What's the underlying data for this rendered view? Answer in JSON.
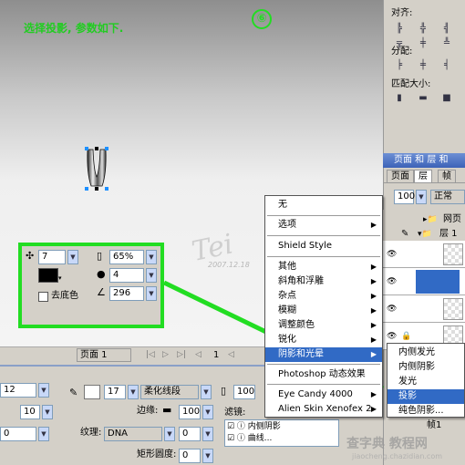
{
  "caption": "选择投影, 参数如下.",
  "step_badge": "⑥",
  "signature": "Tei",
  "signature_date": "2007.12.18",
  "shadow_panel": {
    "distance": "7",
    "opacity": "65%",
    "softness": "4",
    "angle": "296",
    "knockout_label": "去底色",
    "color": "#000000"
  },
  "page_bar": {
    "page_select": "页面 1",
    "page_number": "1"
  },
  "right_panel": {
    "align_label": "对齐:",
    "distribute_label": "分配:",
    "match_size_label": "匹配大小:",
    "layers_header": "页面 和 层 和",
    "tabs": [
      "页面",
      "层",
      "帧"
    ],
    "opacity_value": "100",
    "blend_mode": "正常",
    "layer_items": [
      "网页",
      "层 1"
    ],
    "frames_label": "帧1"
  },
  "bottom_panel": {
    "stroke_size": "17",
    "stroke_style": "柔化线段",
    "edge_label": "边缘:",
    "edge_value": "100",
    "opacity_value": "100",
    "texture_label": "纹理:",
    "texture_value": "DNA",
    "texture_amount": "0",
    "rect_roundness_label": "矩形圆度:",
    "rect_roundness_value": "0",
    "filters_label": "滤镜:",
    "filters": [
      "内侧阴影",
      "曲线..."
    ],
    "left_value1": "12",
    "left_value2": "10",
    "left_value3": "0"
  },
  "menu_main": [
    "无",
    "选项",
    "Shield Style",
    "其他",
    "斜角和浮雕",
    "杂点",
    "模糊",
    "调整颜色",
    "锐化",
    "阴影和光晕",
    "Photoshop 动态效果",
    "Eye Candy 4000",
    "Alien Skin Xenofex 2"
  ],
  "menu_sub": [
    "内侧发光",
    "内侧阴影",
    "发光",
    "投影",
    "纯色阴影..."
  ],
  "watermark": "查字典 教程网",
  "watermark_url": "jiaocheng.chazidian.com",
  "colors": {
    "accent_green": "#22dd22",
    "menu_highlight": "#316ac5"
  }
}
